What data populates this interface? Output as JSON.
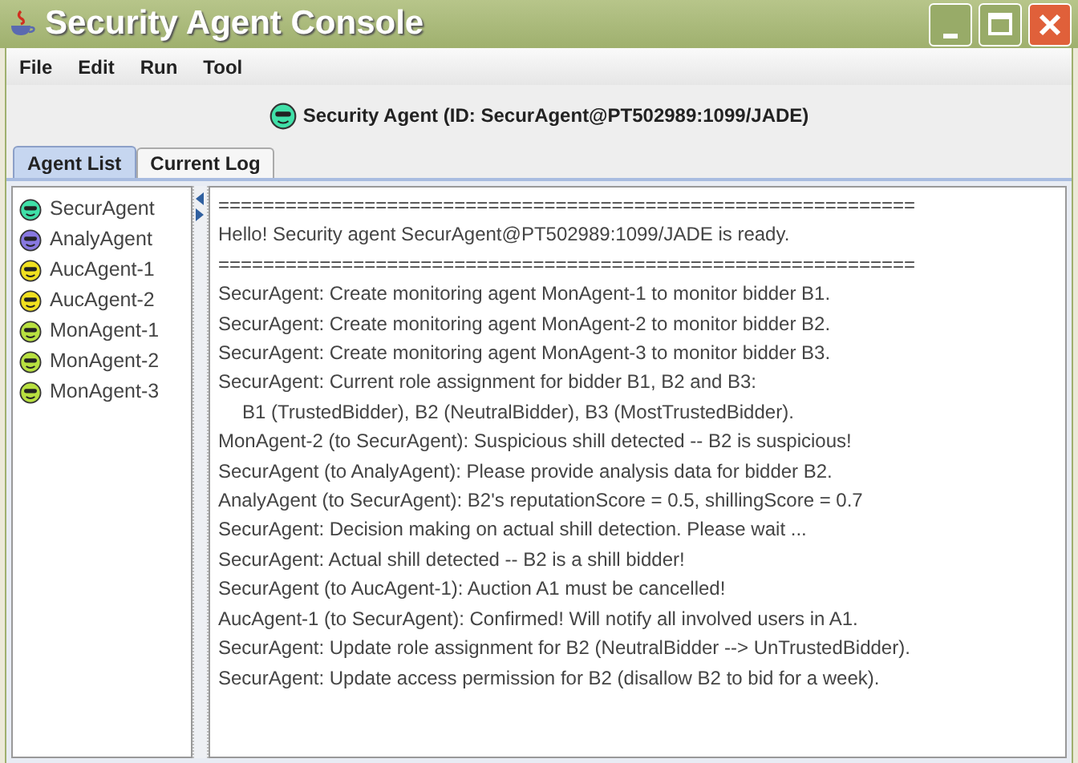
{
  "window": {
    "title": "Security Agent Console"
  },
  "menu": [
    "File",
    "Edit",
    "Run",
    "Tool"
  ],
  "header": {
    "text": "Security Agent (ID: SecurAgent@PT502989:1099/JADE)",
    "color": "#40e0a8"
  },
  "tabs": [
    {
      "label": "Agent List",
      "selected": true
    },
    {
      "label": "Current Log",
      "selected": false
    }
  ],
  "agents": [
    {
      "name": "SecurAgent",
      "color": "#40e0a8"
    },
    {
      "name": "AnalyAgent",
      "color": "#8878e0"
    },
    {
      "name": "AucAgent-1",
      "color": "#f0e020"
    },
    {
      "name": "AucAgent-2",
      "color": "#f0e020"
    },
    {
      "name": "MonAgent-1",
      "color": "#b8e040"
    },
    {
      "name": "MonAgent-2",
      "color": "#b8e040"
    },
    {
      "name": "MonAgent-3",
      "color": "#b8e040"
    }
  ],
  "log": [
    {
      "kind": "line",
      "text": "=============================================================="
    },
    {
      "kind": "line",
      "text": "Hello! Security agent SecurAgent@PT502989:1099/JADE is ready."
    },
    {
      "kind": "line",
      "text": "=============================================================="
    },
    {
      "kind": "line",
      "text": "SecurAgent: Create monitoring agent MonAgent-1 to monitor bidder B1."
    },
    {
      "kind": "line",
      "text": "SecurAgent: Create monitoring agent MonAgent-2 to monitor bidder B2."
    },
    {
      "kind": "line",
      "text": "SecurAgent: Create monitoring agent MonAgent-3 to monitor bidder B3."
    },
    {
      "kind": "line",
      "text": "SecurAgent: Current role assignment for bidder B1, B2 and B3:"
    },
    {
      "kind": "continuation",
      "text": "B1 (TrustedBidder), B2 (NeutralBidder), B3 (MostTrustedBidder)."
    },
    {
      "kind": "line",
      "text": "MonAgent-2 (to SecurAgent): Suspicious shill detected -- B2 is suspicious!"
    },
    {
      "kind": "line",
      "text": "SecurAgent (to AnalyAgent): Please provide analysis data for bidder B2."
    },
    {
      "kind": "line",
      "text": "AnalyAgent (to SecurAgent): B2's reputationScore = 0.5, shillingScore = 0.7"
    },
    {
      "kind": "line",
      "text": "SecurAgent: Decision making on actual shill detection. Please wait ..."
    },
    {
      "kind": "line",
      "text": "SecurAgent: Actual shill detected -- B2 is a shill bidder!"
    },
    {
      "kind": "line",
      "text": "SecurAgent (to AucAgent-1): Auction A1 must be cancelled!"
    },
    {
      "kind": "line",
      "text": "AucAgent-1 (to SecurAgent): Confirmed! Will notify all involved users in A1."
    },
    {
      "kind": "line",
      "text": "SecurAgent: Update role assignment for B2 (NeutralBidder --> UnTrustedBidder)."
    },
    {
      "kind": "line",
      "text": "SecurAgent: Update access permission for B2 (disallow B2 to bid for a week)."
    }
  ]
}
